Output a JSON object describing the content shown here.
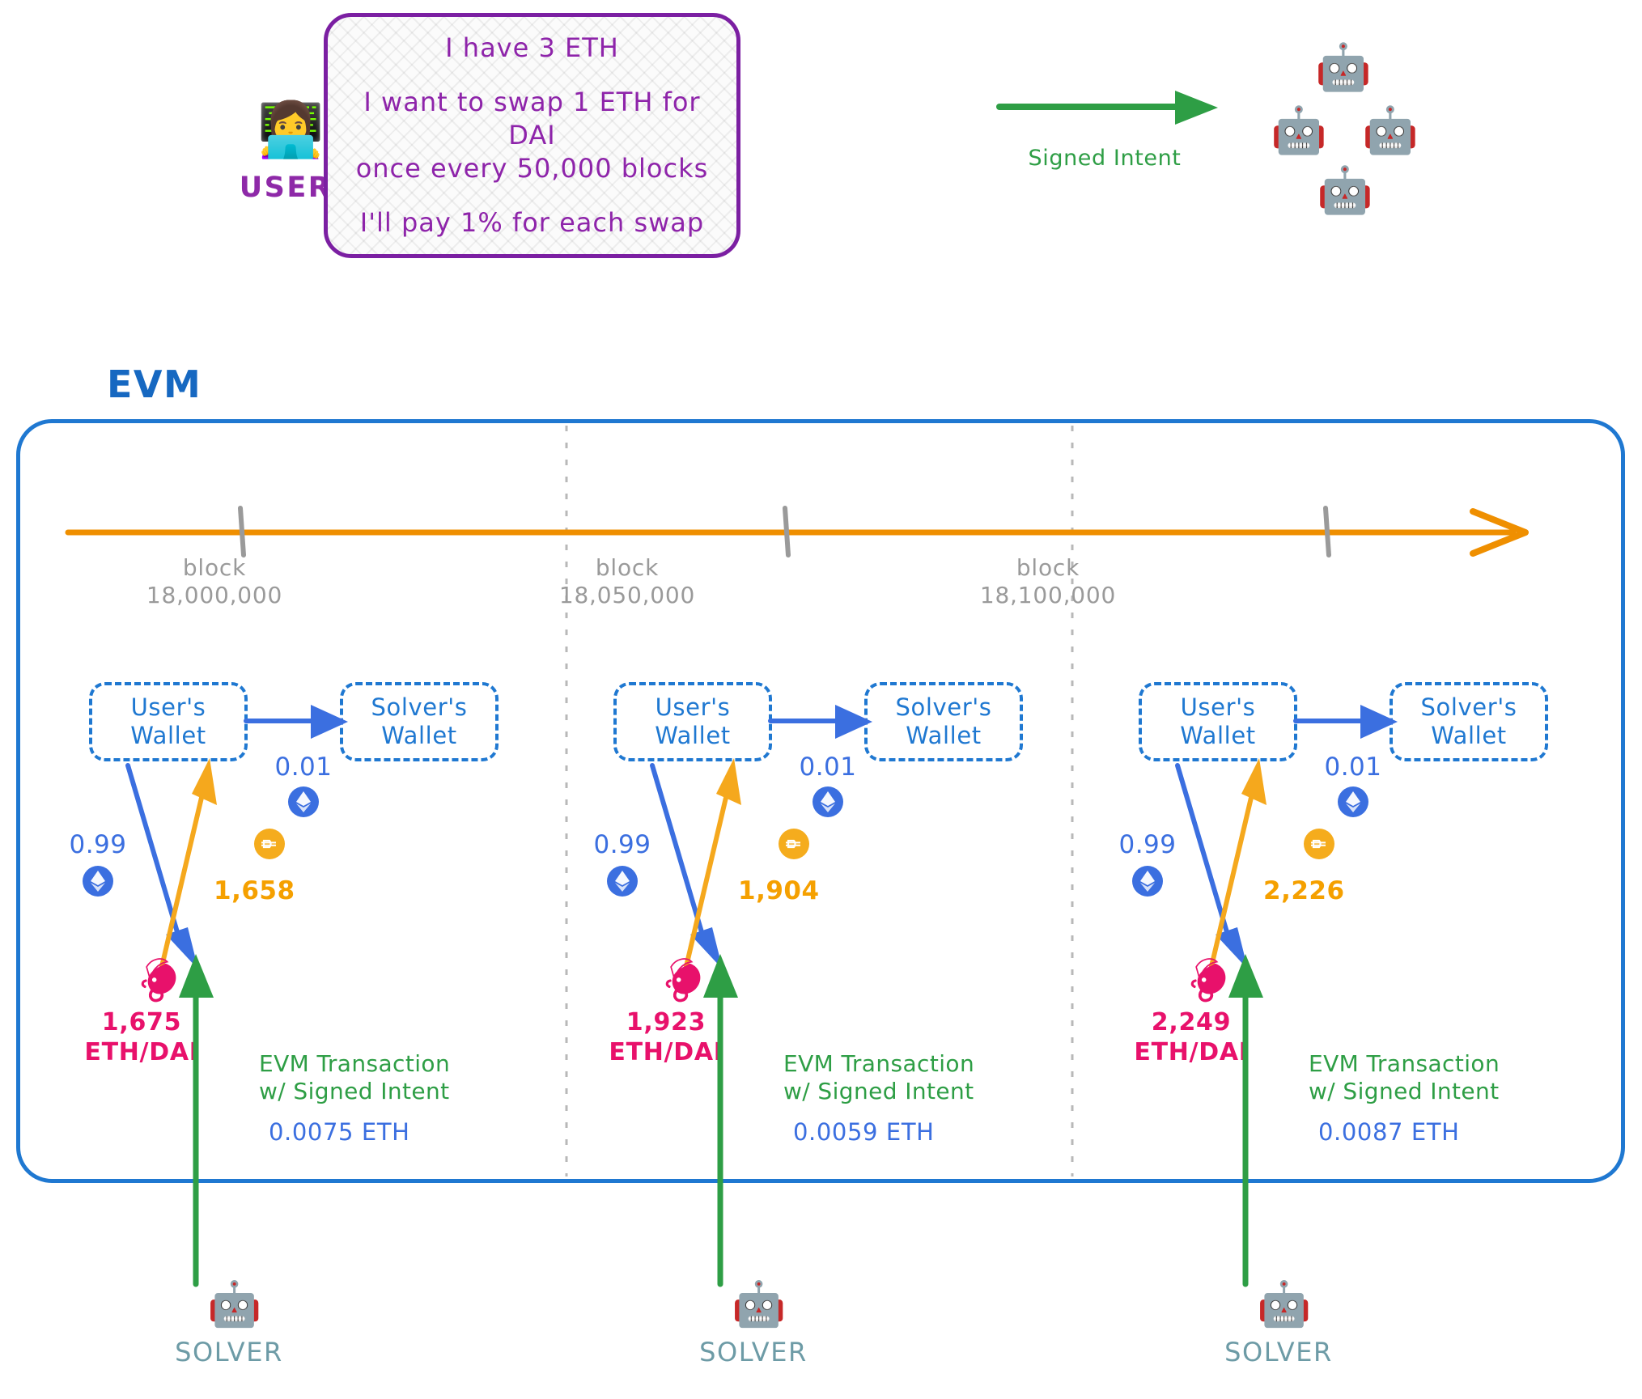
{
  "user": {
    "icon": "woman-technologist-emoji",
    "glyph": "👩‍💻",
    "label": "USER",
    "color": "#8e29a8"
  },
  "intent": {
    "line1": "I have 3 ETH",
    "line2": "I want to swap 1 ETH for DAI\nonce every 50,000 blocks",
    "line3": "I'll pay 1% for each swap",
    "border_color": "#7b1fa2",
    "text_color": "#8e24aa"
  },
  "signed_intent": {
    "label": "Signed Intent",
    "color": "#2e9e45",
    "arrow": "green-right-arrow"
  },
  "solvers_cluster": {
    "icon": "robot-emoji",
    "glyph": "🤖",
    "count": 4
  },
  "evm": {
    "title": "EVM",
    "title_color": "#1668c1",
    "border_color": "#1f78d1"
  },
  "timeline": {
    "axis_color": "#ef8f00",
    "arrow": "orange-right-arrow",
    "blocks": [
      {
        "caption": "block",
        "number": "18,000,000"
      },
      {
        "caption": "block",
        "number": "18,050,000"
      },
      {
        "caption": "block",
        "number": "18,100,000"
      }
    ]
  },
  "columns": [
    {
      "user_wallet": "User's\nWallet",
      "solver_wallet": "Solver's\nWallet",
      "fee_amount": "0.01",
      "fee_token": "eth-token-icon",
      "out_amount": "0.99",
      "out_token": "eth-token-icon",
      "in_amount": "1,658",
      "in_token": "dai-token-icon",
      "dex_icon": "uniswap-unicorn-icon",
      "price_value": "1,675",
      "price_pair": "ETH/DAI",
      "tx_label": "EVM Transaction\nw/ Signed Intent",
      "tx_cost": "0.0075 ETH",
      "solver_icon": "robot-emoji",
      "solver_glyph": "🤖",
      "solver_label": "SOLVER"
    },
    {
      "user_wallet": "User's\nWallet",
      "solver_wallet": "Solver's\nWallet",
      "fee_amount": "0.01",
      "fee_token": "eth-token-icon",
      "out_amount": "0.99",
      "out_token": "eth-token-icon",
      "in_amount": "1,904",
      "in_token": "dai-token-icon",
      "dex_icon": "uniswap-unicorn-icon",
      "price_value": "1,923",
      "price_pair": "ETH/DAI",
      "tx_label": "EVM Transaction\nw/ Signed Intent",
      "tx_cost": "0.0059 ETH",
      "solver_icon": "robot-emoji",
      "solver_glyph": "🤖",
      "solver_label": "SOLVER"
    },
    {
      "user_wallet": "User's\nWallet",
      "solver_wallet": "Solver's\nWallet",
      "fee_amount": "0.01",
      "fee_token": "eth-token-icon",
      "out_amount": "0.99",
      "out_token": "eth-token-icon",
      "in_amount": "2,226",
      "in_token": "dai-token-icon",
      "dex_icon": "uniswap-unicorn-icon",
      "price_value": "2,249",
      "price_pair": "ETH/DAI",
      "tx_label": "EVM Transaction\nw/ Signed Intent",
      "tx_cost": "0.0087 ETH",
      "solver_icon": "robot-emoji",
      "solver_glyph": "🤖",
      "solver_label": "SOLVER"
    }
  ],
  "colors": {
    "eth_blue": "#3b6fe0",
    "dai_orange": "#f5ac1d",
    "uniswap_pink": "#e8116b",
    "green": "#2e9e45",
    "solver_teal": "#6d9ba6",
    "gray_block": "#9a9a9a"
  }
}
